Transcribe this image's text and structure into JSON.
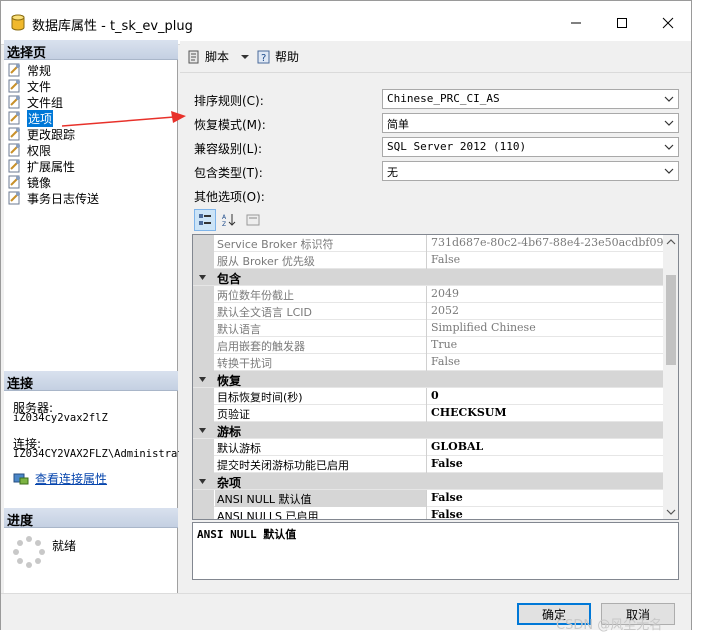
{
  "window": {
    "title": "数据库属性 - t_sk_ev_plug",
    "icon": "database-icon"
  },
  "left_pane": {
    "select_page_header": "选择页",
    "items": [
      {
        "label": "常规",
        "icon": "page-wrench-icon",
        "selected": false
      },
      {
        "label": "文件",
        "icon": "page-wrench-icon",
        "selected": false
      },
      {
        "label": "文件组",
        "icon": "page-wrench-icon",
        "selected": false
      },
      {
        "label": "选项",
        "icon": "page-wrench-icon",
        "selected": true
      },
      {
        "label": "更改跟踪",
        "icon": "page-wrench-icon",
        "selected": false
      },
      {
        "label": "权限",
        "icon": "page-wrench-icon",
        "selected": false
      },
      {
        "label": "扩展属性",
        "icon": "page-wrench-icon",
        "selected": false
      },
      {
        "label": "镜像",
        "icon": "page-wrench-icon",
        "selected": false
      },
      {
        "label": "事务日志传送",
        "icon": "page-wrench-icon",
        "selected": false
      }
    ],
    "connection_header": "连接",
    "server_label": "服务器:",
    "server_value": "iZ034cy2vax2flZ",
    "connection_label": "连接:",
    "connection_value": "IZ034CY2VAX2FLZ\\Administrat",
    "view_connection_link": "查看连接属性",
    "progress_header": "进度",
    "progress_status": "就绪"
  },
  "toolbar": {
    "script_label": "脚本",
    "help_label": "帮助"
  },
  "form": {
    "collation_label": "排序规则(C):",
    "collation_value": "Chinese_PRC_CI_AS",
    "recovery_label": "恢复模式(M):",
    "recovery_value": "简单",
    "compat_label": "兼容级别(L):",
    "compat_value": "SQL Server 2012 (110)",
    "containment_label": "包含类型(T):",
    "containment_value": "无",
    "other_options_label": "其他选项(O):"
  },
  "grid": {
    "rows": [
      {
        "kind": "prop",
        "name": "Service Broker 标识符",
        "value": "731d687e-80c2-4b67-88e4-23e50acdbf09",
        "dim": true,
        "bold": false
      },
      {
        "kind": "prop",
        "name": "服从 Broker 优先级",
        "value": "False",
        "dim": true,
        "bold": false
      },
      {
        "kind": "cat",
        "name": "包含"
      },
      {
        "kind": "prop",
        "name": "两位数年份截止",
        "value": "2049",
        "dim": true,
        "bold": false
      },
      {
        "kind": "prop",
        "name": "默认全文语言 LCID",
        "value": "2052",
        "dim": true,
        "bold": false
      },
      {
        "kind": "prop",
        "name": "默认语言",
        "value": "Simplified Chinese",
        "dim": true,
        "bold": false
      },
      {
        "kind": "prop",
        "name": "启用嵌套的触发器",
        "value": "True",
        "dim": true,
        "bold": false
      },
      {
        "kind": "prop",
        "name": "转换干扰词",
        "value": "False",
        "dim": true,
        "bold": false
      },
      {
        "kind": "cat",
        "name": "恢复"
      },
      {
        "kind": "prop",
        "name": "目标恢复时间(秒)",
        "value": "0",
        "dim": false,
        "bold": true
      },
      {
        "kind": "prop",
        "name": "页验证",
        "value": "CHECKSUM",
        "dim": false,
        "bold": true
      },
      {
        "kind": "cat",
        "name": "游标"
      },
      {
        "kind": "prop",
        "name": "默认游标",
        "value": "GLOBAL",
        "dim": false,
        "bold": true
      },
      {
        "kind": "prop",
        "name": "提交时关闭游标功能已启用",
        "value": "False",
        "dim": false,
        "bold": true
      },
      {
        "kind": "cat",
        "name": "杂项"
      },
      {
        "kind": "prop",
        "name": "ANSI NULL 默认值",
        "value": "False",
        "dim": false,
        "bold": true,
        "selected": true
      },
      {
        "kind": "prop",
        "name": "ANSI NULLS 已启用",
        "value": "False",
        "dim": false,
        "bold": true
      }
    ]
  },
  "description": {
    "text": "ANSI NULL 默认值"
  },
  "buttons": {
    "ok_label": "确定",
    "cancel_label": "取消"
  },
  "watermark": "CSDN @风尘无名",
  "colors": {
    "selection_blue": "#0078d7",
    "annotation_red": "#e8312a",
    "category_gray": "#d6d6d6"
  }
}
